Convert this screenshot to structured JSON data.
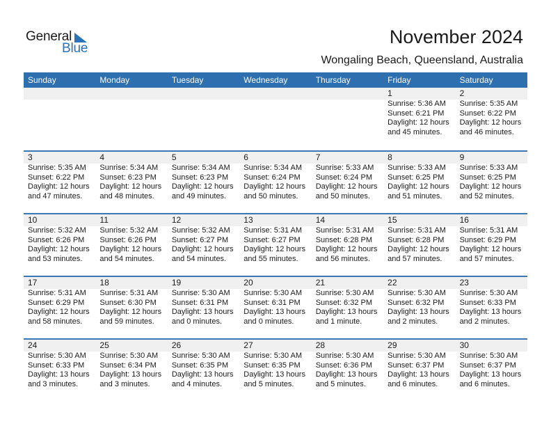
{
  "logo": {
    "word1": "General",
    "word2": "Blue"
  },
  "header": {
    "title": "November 2024",
    "location": "Wongaling Beach, Queensland, Australia"
  },
  "colors": {
    "accent": "#2e6fb0",
    "band": "#f0f0f0"
  },
  "weekdays": [
    "Sunday",
    "Monday",
    "Tuesday",
    "Wednesday",
    "Thursday",
    "Friday",
    "Saturday"
  ],
  "weeks": [
    [
      null,
      null,
      null,
      null,
      null,
      {
        "day": "1",
        "sunrise": "Sunrise: 5:36 AM",
        "sunset": "Sunset: 6:21 PM",
        "daylight1": "Daylight: 12 hours",
        "daylight2": "and 45 minutes."
      },
      {
        "day": "2",
        "sunrise": "Sunrise: 5:35 AM",
        "sunset": "Sunset: 6:22 PM",
        "daylight1": "Daylight: 12 hours",
        "daylight2": "and 46 minutes."
      }
    ],
    [
      {
        "day": "3",
        "sunrise": "Sunrise: 5:35 AM",
        "sunset": "Sunset: 6:22 PM",
        "daylight1": "Daylight: 12 hours",
        "daylight2": "and 47 minutes."
      },
      {
        "day": "4",
        "sunrise": "Sunrise: 5:34 AM",
        "sunset": "Sunset: 6:23 PM",
        "daylight1": "Daylight: 12 hours",
        "daylight2": "and 48 minutes."
      },
      {
        "day": "5",
        "sunrise": "Sunrise: 5:34 AM",
        "sunset": "Sunset: 6:23 PM",
        "daylight1": "Daylight: 12 hours",
        "daylight2": "and 49 minutes."
      },
      {
        "day": "6",
        "sunrise": "Sunrise: 5:34 AM",
        "sunset": "Sunset: 6:24 PM",
        "daylight1": "Daylight: 12 hours",
        "daylight2": "and 50 minutes."
      },
      {
        "day": "7",
        "sunrise": "Sunrise: 5:33 AM",
        "sunset": "Sunset: 6:24 PM",
        "daylight1": "Daylight: 12 hours",
        "daylight2": "and 50 minutes."
      },
      {
        "day": "8",
        "sunrise": "Sunrise: 5:33 AM",
        "sunset": "Sunset: 6:25 PM",
        "daylight1": "Daylight: 12 hours",
        "daylight2": "and 51 minutes."
      },
      {
        "day": "9",
        "sunrise": "Sunrise: 5:33 AM",
        "sunset": "Sunset: 6:25 PM",
        "daylight1": "Daylight: 12 hours",
        "daylight2": "and 52 minutes."
      }
    ],
    [
      {
        "day": "10",
        "sunrise": "Sunrise: 5:32 AM",
        "sunset": "Sunset: 6:26 PM",
        "daylight1": "Daylight: 12 hours",
        "daylight2": "and 53 minutes."
      },
      {
        "day": "11",
        "sunrise": "Sunrise: 5:32 AM",
        "sunset": "Sunset: 6:26 PM",
        "daylight1": "Daylight: 12 hours",
        "daylight2": "and 54 minutes."
      },
      {
        "day": "12",
        "sunrise": "Sunrise: 5:32 AM",
        "sunset": "Sunset: 6:27 PM",
        "daylight1": "Daylight: 12 hours",
        "daylight2": "and 54 minutes."
      },
      {
        "day": "13",
        "sunrise": "Sunrise: 5:31 AM",
        "sunset": "Sunset: 6:27 PM",
        "daylight1": "Daylight: 12 hours",
        "daylight2": "and 55 minutes."
      },
      {
        "day": "14",
        "sunrise": "Sunrise: 5:31 AM",
        "sunset": "Sunset: 6:28 PM",
        "daylight1": "Daylight: 12 hours",
        "daylight2": "and 56 minutes."
      },
      {
        "day": "15",
        "sunrise": "Sunrise: 5:31 AM",
        "sunset": "Sunset: 6:28 PM",
        "daylight1": "Daylight: 12 hours",
        "daylight2": "and 57 minutes."
      },
      {
        "day": "16",
        "sunrise": "Sunrise: 5:31 AM",
        "sunset": "Sunset: 6:29 PM",
        "daylight1": "Daylight: 12 hours",
        "daylight2": "and 57 minutes."
      }
    ],
    [
      {
        "day": "17",
        "sunrise": "Sunrise: 5:31 AM",
        "sunset": "Sunset: 6:29 PM",
        "daylight1": "Daylight: 12 hours",
        "daylight2": "and 58 minutes."
      },
      {
        "day": "18",
        "sunrise": "Sunrise: 5:31 AM",
        "sunset": "Sunset: 6:30 PM",
        "daylight1": "Daylight: 12 hours",
        "daylight2": "and 59 minutes."
      },
      {
        "day": "19",
        "sunrise": "Sunrise: 5:30 AM",
        "sunset": "Sunset: 6:31 PM",
        "daylight1": "Daylight: 13 hours",
        "daylight2": "and 0 minutes."
      },
      {
        "day": "20",
        "sunrise": "Sunrise: 5:30 AM",
        "sunset": "Sunset: 6:31 PM",
        "daylight1": "Daylight: 13 hours",
        "daylight2": "and 0 minutes."
      },
      {
        "day": "21",
        "sunrise": "Sunrise: 5:30 AM",
        "sunset": "Sunset: 6:32 PM",
        "daylight1": "Daylight: 13 hours",
        "daylight2": "and 1 minute."
      },
      {
        "day": "22",
        "sunrise": "Sunrise: 5:30 AM",
        "sunset": "Sunset: 6:32 PM",
        "daylight1": "Daylight: 13 hours",
        "daylight2": "and 2 minutes."
      },
      {
        "day": "23",
        "sunrise": "Sunrise: 5:30 AM",
        "sunset": "Sunset: 6:33 PM",
        "daylight1": "Daylight: 13 hours",
        "daylight2": "and 2 minutes."
      }
    ],
    [
      {
        "day": "24",
        "sunrise": "Sunrise: 5:30 AM",
        "sunset": "Sunset: 6:33 PM",
        "daylight1": "Daylight: 13 hours",
        "daylight2": "and 3 minutes."
      },
      {
        "day": "25",
        "sunrise": "Sunrise: 5:30 AM",
        "sunset": "Sunset: 6:34 PM",
        "daylight1": "Daylight: 13 hours",
        "daylight2": "and 3 minutes."
      },
      {
        "day": "26",
        "sunrise": "Sunrise: 5:30 AM",
        "sunset": "Sunset: 6:35 PM",
        "daylight1": "Daylight: 13 hours",
        "daylight2": "and 4 minutes."
      },
      {
        "day": "27",
        "sunrise": "Sunrise: 5:30 AM",
        "sunset": "Sunset: 6:35 PM",
        "daylight1": "Daylight: 13 hours",
        "daylight2": "and 5 minutes."
      },
      {
        "day": "28",
        "sunrise": "Sunrise: 5:30 AM",
        "sunset": "Sunset: 6:36 PM",
        "daylight1": "Daylight: 13 hours",
        "daylight2": "and 5 minutes."
      },
      {
        "day": "29",
        "sunrise": "Sunrise: 5:30 AM",
        "sunset": "Sunset: 6:37 PM",
        "daylight1": "Daylight: 13 hours",
        "daylight2": "and 6 minutes."
      },
      {
        "day": "30",
        "sunrise": "Sunrise: 5:30 AM",
        "sunset": "Sunset: 6:37 PM",
        "daylight1": "Daylight: 13 hours",
        "daylight2": "and 6 minutes."
      }
    ]
  ]
}
